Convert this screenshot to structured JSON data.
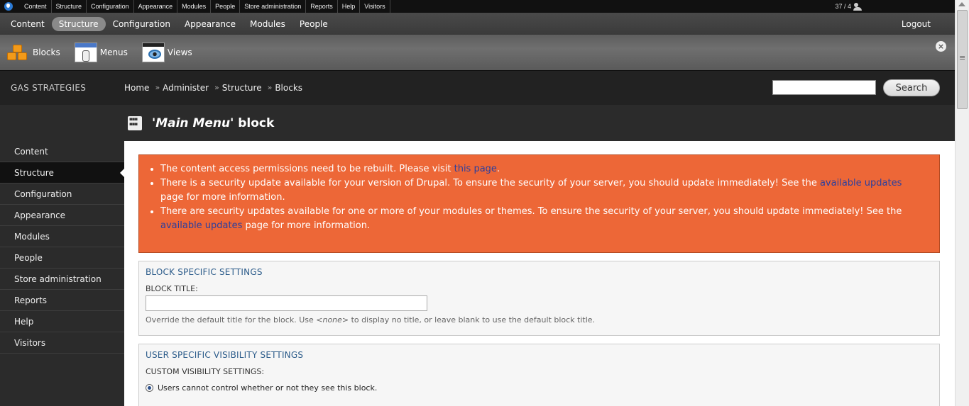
{
  "admin_menu": {
    "items": [
      "Content",
      "Structure",
      "Configuration",
      "Appearance",
      "Modules",
      "People",
      "Store administration",
      "Reports",
      "Help",
      "Visitors"
    ],
    "counts": "37 / 4"
  },
  "toolbar": {
    "items": [
      "Content",
      "Structure",
      "Configuration",
      "Appearance",
      "Modules",
      "People"
    ],
    "active": "Structure",
    "logout": "Logout"
  },
  "shortcuts": {
    "items": [
      {
        "label": "Blocks",
        "icon": "blocks-icon"
      },
      {
        "label": "Menus",
        "icon": "menus-icon"
      },
      {
        "label": "Views",
        "icon": "views-icon"
      }
    ]
  },
  "header": {
    "site_name": "GAS STRATEGIES",
    "breadcrumb": [
      "Home",
      "Administer",
      "Structure",
      "Blocks"
    ],
    "search_button": "Search"
  },
  "sidebar": {
    "items": [
      "Content",
      "Structure",
      "Configuration",
      "Appearance",
      "Modules",
      "People",
      "Store administration",
      "Reports",
      "Help",
      "Visitors"
    ],
    "active": "Structure"
  },
  "page": {
    "title_em": "'Main Menu'",
    "title_rest": " block"
  },
  "messages": {
    "m1_text": "The content access permissions need to be rebuilt. Please visit ",
    "m1_link": "this page",
    "m1_end": ".",
    "m2_text": "There is a security update available for your version of Drupal. To ensure the security of your server, you should update immediately! See the ",
    "m2_link": "available updates",
    "m2_end": " page for more information.",
    "m3_text": "There are security updates available for one or more of your modules or themes. To ensure the security of your server, you should update immediately! See the ",
    "m3_link": "available updates",
    "m3_end": " page for more information."
  },
  "block_settings": {
    "legend": "BLOCK SPECIFIC SETTINGS",
    "title_label": "BLOCK TITLE:",
    "title_value": "",
    "desc_start": "Override the default title for the block. Use ",
    "desc_em": "<none>",
    "desc_end": " to display no title, or leave blank to use the default block title."
  },
  "user_visibility": {
    "legend": "USER SPECIFIC VISIBILITY SETTINGS",
    "label": "CUSTOM VISIBILITY SETTINGS:",
    "option1": "Users cannot control whether or not they see this block."
  },
  "colors": {
    "message_bg": "#ed6737",
    "link": "#2b3f9e",
    "legend": "#2b5b8a"
  }
}
